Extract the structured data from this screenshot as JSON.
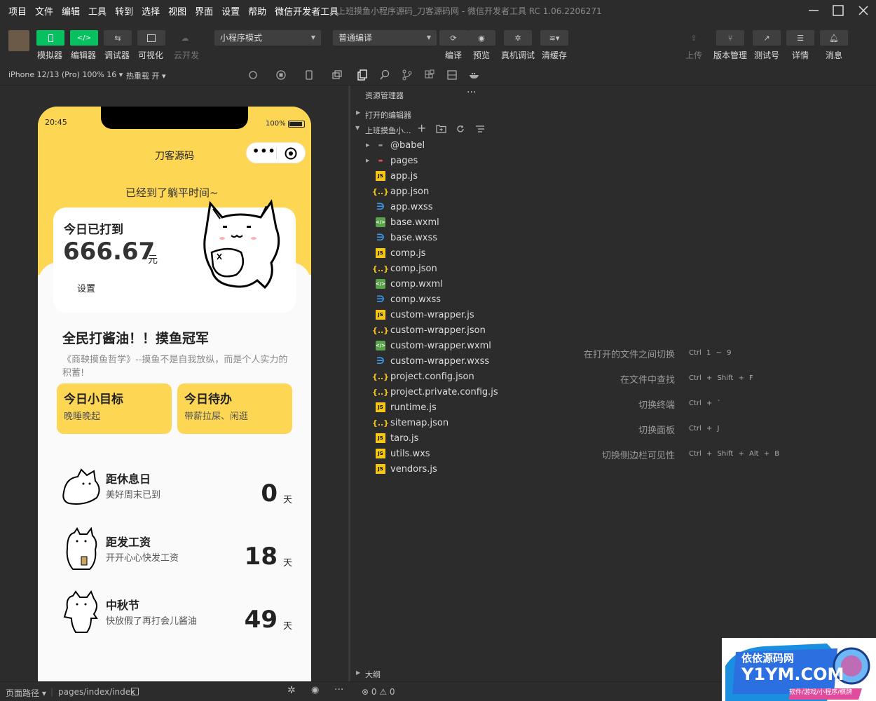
{
  "menu": [
    "项目",
    "文件",
    "编辑",
    "工具",
    "转到",
    "选择",
    "视图",
    "界面",
    "设置",
    "帮助",
    "微信开发者工具"
  ],
  "window_title": "上班摸鱼小程序源码_刀客源码网 - 微信开发者工具 RC 1.06.2206271",
  "toolbar": {
    "left_buttons": [
      "模拟器",
      "编辑器",
      "调试器",
      "可视化",
      "云开发"
    ],
    "mode_select": "小程序模式",
    "compile_select": "普通编译",
    "mid_buttons": [
      "编译",
      "预览",
      "真机调试",
      "清缓存"
    ],
    "right_buttons": [
      "上传",
      "版本管理",
      "测试号",
      "详情",
      "消息"
    ]
  },
  "subbar": {
    "device": "iPhone 12/13 (Pro) 100% 16 ▾",
    "hot_reload": "热重载 开 ▾"
  },
  "phone": {
    "time": "20:45",
    "battery": "100%",
    "nav_title": "刀客源码",
    "greeting": "已经到了躺平时间~",
    "card_title": "今日已打到",
    "amount": "666.67",
    "amount_unit": "元",
    "settings": "设置",
    "slogan_title": "全民打酱油！！摸鱼冠军",
    "slogan_desc": "《商鞅摸鱼哲学》--摸鱼不是自我放纵，而是个人实力的积蓄!",
    "goals": [
      {
        "title": "今日小目标",
        "sub": "晚睡晚起"
      },
      {
        "title": "今日待办",
        "sub": "带薪拉屎、闲逛"
      }
    ],
    "countdowns": [
      {
        "title": "距休息日",
        "sub": "美好周末已到",
        "days": "0",
        "unit": "天"
      },
      {
        "title": "距发工资",
        "sub": "开开心心快发工资",
        "days": "18",
        "unit": "天"
      },
      {
        "title": "中秋节",
        "sub": "快放假了再打会儿酱油",
        "days": "49",
        "unit": "天"
      }
    ]
  },
  "explorer": {
    "title": "资源管理器",
    "more": "···",
    "open_editors": "打开的编辑器",
    "project": "上班摸鱼小...",
    "outline": "大纲",
    "files": [
      {
        "name": "@babel",
        "type": "folder"
      },
      {
        "name": "pages",
        "type": "pages"
      },
      {
        "name": "app.js",
        "type": "js"
      },
      {
        "name": "app.json",
        "type": "json"
      },
      {
        "name": "app.wxss",
        "type": "wxss"
      },
      {
        "name": "base.wxml",
        "type": "wxml"
      },
      {
        "name": "base.wxss",
        "type": "wxss"
      },
      {
        "name": "comp.js",
        "type": "js"
      },
      {
        "name": "comp.json",
        "type": "json"
      },
      {
        "name": "comp.wxml",
        "type": "wxml"
      },
      {
        "name": "comp.wxss",
        "type": "wxss"
      },
      {
        "name": "custom-wrapper.js",
        "type": "js"
      },
      {
        "name": "custom-wrapper.json",
        "type": "json"
      },
      {
        "name": "custom-wrapper.wxml",
        "type": "wxml"
      },
      {
        "name": "custom-wrapper.wxss",
        "type": "wxss"
      },
      {
        "name": "project.config.json",
        "type": "json"
      },
      {
        "name": "project.private.config.js...",
        "type": "json"
      },
      {
        "name": "runtime.js",
        "type": "js"
      },
      {
        "name": "sitemap.json",
        "type": "json"
      },
      {
        "name": "taro.js",
        "type": "js"
      },
      {
        "name": "utils.wxs",
        "type": "js"
      },
      {
        "name": "vendors.js",
        "type": "js"
      }
    ]
  },
  "shortcuts": [
    {
      "label": "在打开的文件之间切换",
      "keys": "Ctrl 1 ~ 9"
    },
    {
      "label": "在文件中查找",
      "keys": "Ctrl + Shift + F"
    },
    {
      "label": "切换终端",
      "keys": "Ctrl + `"
    },
    {
      "label": "切换面板",
      "keys": "Ctrl + J"
    },
    {
      "label": "切换侧边栏可见性",
      "keys": "Ctrl + Shift + Alt + B"
    }
  ],
  "statusbar": {
    "page_path_label": "页面路径 ▾",
    "page_path": "pages/index/index",
    "problems": "⊗ 0 ⚠ 0"
  },
  "watermark": {
    "line1": "依依源码网",
    "line2": "Y1YM.COM",
    "line3": "软件/游戏/小程序/棋牌"
  },
  "colors": {
    "accent_green": "#07c160",
    "phone_yellow": "#fdd653"
  }
}
